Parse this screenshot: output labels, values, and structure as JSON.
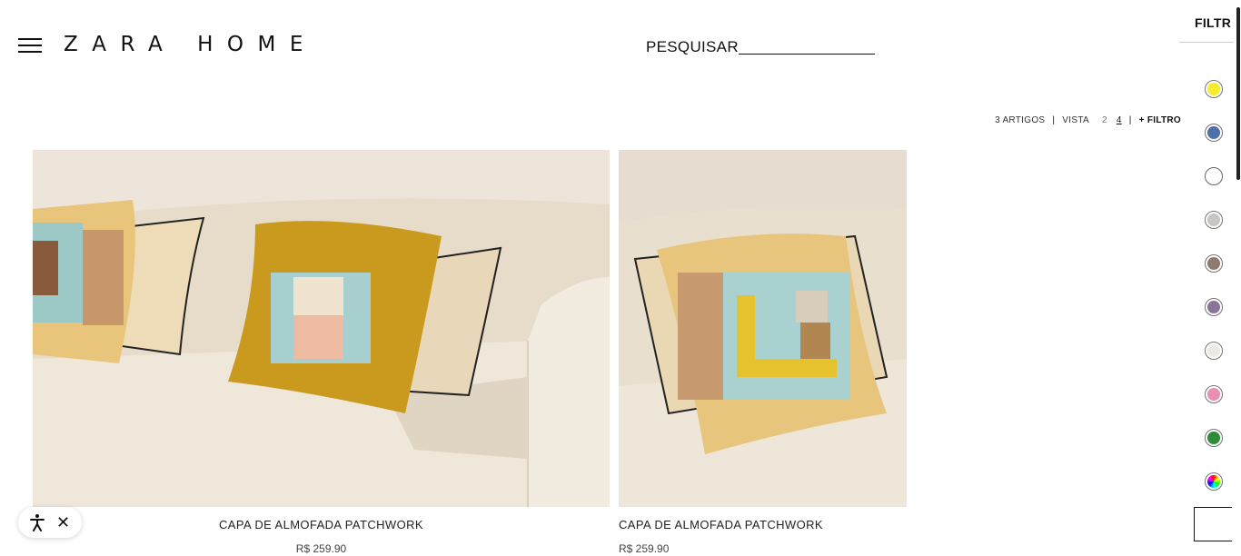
{
  "header": {
    "logo": "ZARA HOME",
    "search_label": "PESQUISAR"
  },
  "toolbar": {
    "count": "3 ARTIGOS",
    "divider": "|",
    "view_label": "VISTA",
    "view_options": [
      "2",
      "4"
    ],
    "active_view": "4",
    "filter_label": "+ FILTRO"
  },
  "products": [
    {
      "name": "CAPA DE ALMOFADA PATCHWORK",
      "price": "R$ 259.90"
    },
    {
      "name": "CAPA DE ALMOFADA PATCHWORK",
      "price": "R$ 259.90"
    }
  ],
  "filter_panel": {
    "title": "FILTR",
    "colors": [
      {
        "name": "yellow",
        "hex": "#f5ec2e"
      },
      {
        "name": "blue",
        "hex": "#4e6fa8"
      },
      {
        "name": "white",
        "hex": "#ffffff"
      },
      {
        "name": "grey",
        "hex": "#c8c6c4"
      },
      {
        "name": "brown",
        "hex": "#8f7a6c"
      },
      {
        "name": "purple",
        "hex": "#8a7597"
      },
      {
        "name": "ecru",
        "hex": "#ece9e2"
      },
      {
        "name": "pink",
        "hex": "#e98fb6"
      },
      {
        "name": "green",
        "hex": "#2f8c38"
      },
      {
        "name": "multicolor",
        "hex": "conic-gradient(#f00,#ff0,#0f0,#0ff,#00f,#f0f,#f00)"
      }
    ]
  },
  "accessibility": {
    "icon": "accessibility-icon",
    "close_icon": "close-icon",
    "close_glyph": "✕"
  }
}
